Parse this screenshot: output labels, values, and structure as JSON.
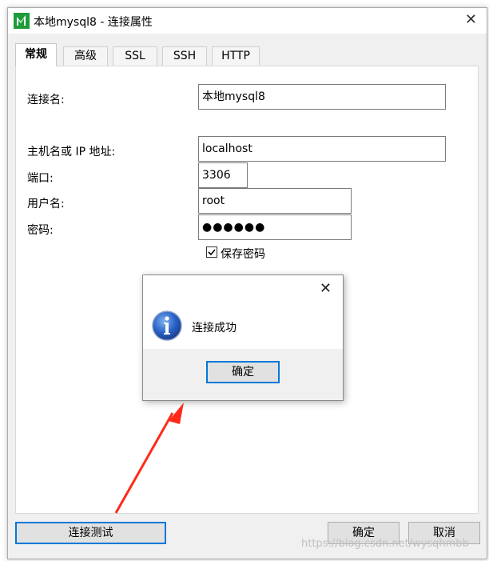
{
  "window": {
    "title": "本地mysql8 - 连接属性",
    "close_glyph": "✕"
  },
  "tabs": [
    {
      "label": "常规",
      "active": true
    },
    {
      "label": "高级"
    },
    {
      "label": "SSL"
    },
    {
      "label": "SSH"
    },
    {
      "label": "HTTP"
    }
  ],
  "form": {
    "connection_name_label": "连接名:",
    "connection_name_value": "本地mysql8",
    "host_label": "主机名或 IP 地址:",
    "host_value": "localhost",
    "port_label": "端口:",
    "port_value": "3306",
    "username_label": "用户名:",
    "username_value": "root",
    "password_label": "密码:",
    "password_value": "●●●●●●",
    "save_password_label": "保存密码",
    "save_password_checked": true
  },
  "dialog": {
    "close_glyph": "✕",
    "message": "连接成功",
    "ok_label": "确定",
    "icon": "info-icon"
  },
  "buttons": {
    "test_connection": "连接测试",
    "ok": "确定",
    "cancel": "取消"
  },
  "colors": {
    "focus_border": "#0078d7",
    "arrow": "#ff2a1a",
    "app_icon": "#1e9b3a"
  },
  "watermark": "https://blog.csdn.net/wysqhmbb"
}
